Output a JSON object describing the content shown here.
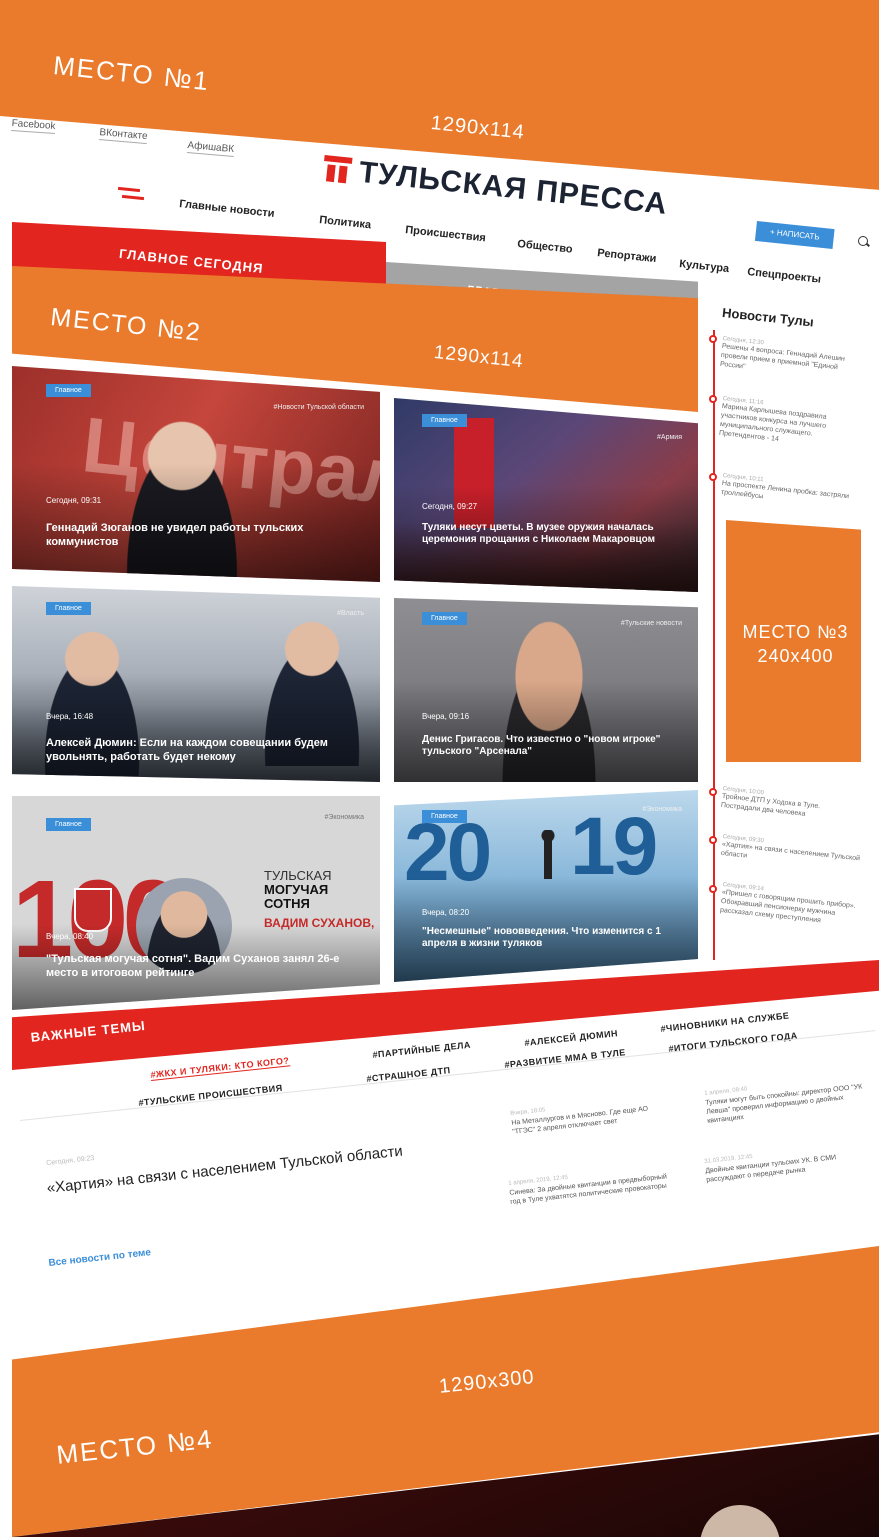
{
  "place1": {
    "title": "МЕСТО №1",
    "size": "1290x114"
  },
  "social": [
    "Facebook",
    "ВКонтакте",
    "АфишаВК"
  ],
  "logo": {
    "text": "ТУЛЬСКАЯ ПРЕССА"
  },
  "write_button": "+ НАПИСАТЬ",
  "nav": [
    "Главные новости",
    "Политика",
    "Происшествия",
    "Общество",
    "Репортажи",
    "Культура",
    "Спецпроекты"
  ],
  "tabs": [
    "ГЛАВНОЕ СЕГОДНЯ",
    "ГЛАВНОЕ ЗА НЕДЕЛЮ"
  ],
  "place2": {
    "title": "МЕСТО №2",
    "size": "1290x114"
  },
  "sidebar": {
    "title": "Новости Тулы",
    "items": [
      {
        "time": "Сегодня, 12:30",
        "text": "Решены 4 вопроса: Геннадий Алешин провели прием в приемной \"Единой России\""
      },
      {
        "time": "Сегодня, 11:16",
        "text": "Марина Карлышева поздравила участников конкурса на лучшего муниципального служащего. Претендентов - 14"
      },
      {
        "time": "Сегодня, 10:11",
        "text": "На проспекте Ленина пробка: застряли троллейбусы"
      },
      {
        "time": "Сегодня, 10:00",
        "text": "Тройное ДТП у Ходока в Туле. Пострадали два человека"
      },
      {
        "time": "Сегодня, 09:30",
        "text": "«Хартия» на связи с населением Тульской области"
      },
      {
        "time": "Сегодня, 09:14",
        "text": "«Пришел с говорящим прошить прибор». Обокравший пенсионерку мужчина рассказал схему преступления"
      }
    ]
  },
  "place3": {
    "title": "МЕСТО №3",
    "size": "240x400"
  },
  "cards": [
    {
      "badge": "Главное",
      "tag": "#Новости Тульской области",
      "time": "Сегодня, 09:31",
      "title": "Геннадий Зюганов не увидел работы тульских коммунистов"
    },
    {
      "badge": "Главное",
      "tag": "#Армия",
      "time": "Сегодня, 09:27",
      "title": "Туляки несут цветы. В музее оружия началась церемония прощания с Николаем Макаровцом"
    },
    {
      "badge": "Главное",
      "tag": "#Власть",
      "time": "Вчера, 16:48",
      "title": "Алексей Дюмин: Если на каждом совещании будем увольнять, работать будет некому"
    },
    {
      "badge": "Главное",
      "tag": "#Тульские новости",
      "time": "Вчера, 09:16",
      "title": "Денис Григасов. Что известно о \"новом игроке\" тульского \"Арсенала\""
    },
    {
      "badge": "Главное",
      "tag": "#Экономика",
      "time": "Вчера, 08:40",
      "title": "\"Тульская могучая сотня\". Вадим Суханов занял 26-е место в итоговом рейтинге"
    },
    {
      "badge": "Главное",
      "tag": "#Экономика",
      "time": "Вчера, 08:20",
      "title": "\"Несмешные\" нововведения. Что изменится с 1 апреля в жизни туляков"
    }
  ],
  "card_art": {
    "zyuganov_bg_text": "Централ",
    "sotnya": {
      "number": "100",
      "l1": "ТУЛЬСКАЯ",
      "l2": "МОГУЧАЯ",
      "l3": "СОТНЯ",
      "name": "ВАДИМ СУХАНОВ,"
    },
    "year": [
      "20",
      "19"
    ]
  },
  "important": {
    "title": "ВАЖНЫЕ ТЕМЫ",
    "topics": [
      "#ЖКХ И ТУЛЯКИ: КТО КОГО?",
      "#ПАРТИЙНЫЕ ДЕЛА",
      "#АЛЕКСЕЙ ДЮМИН",
      "#ЧИНОВНИКИ НА СЛУЖБЕ",
      "#ТУЛЬСКИЕ ПРОИСШЕСТВИЯ",
      "#СТРАШНОЕ ДТП",
      "#РАЗВИТИЕ ММА В ТУЛЕ",
      "#ИТОГИ ТУЛЬСКОГО ГОДА"
    ],
    "main_time": "Сегодня, 09:23",
    "main_title": "«Хартия» на связи с населением Тульской области",
    "side": [
      {
        "time": "Вчера, 18:05",
        "text": "На Металлургов и в Мясново. Где еще АО \"ТГЭС\" 2 апреля отключает свет"
      },
      {
        "time": "1 апреля, 08:40",
        "text": "Туляки могут быть спокойны: директор ООО \"УК Левша\" проверил информацию о двойных квитанциях"
      },
      {
        "time": "1 апреля, 2019, 12:45",
        "text": "Синева: За двойные квитанции в предвыборный год в Туле ухватятся политические провокаторы"
      },
      {
        "time": "31.03.2019, 12:45",
        "text": "Двойные квитанции тульских УК. В СМИ рассуждают о передаче рынка"
      }
    ],
    "all_news": "Все новости по теме"
  },
  "place4": {
    "title": "МЕСТО №4",
    "size": "1290x300"
  }
}
